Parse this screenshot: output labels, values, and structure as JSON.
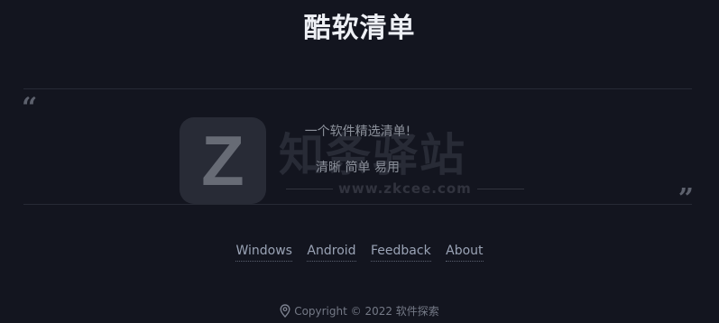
{
  "header": {
    "title": "酷软清单"
  },
  "quote": {
    "open_mark": "“",
    "close_mark": "”",
    "line1": "一个软件精选清单!",
    "line2": "清晰 简单 易用"
  },
  "watermark": {
    "logo_letter": "Z",
    "title": "知条驿站",
    "url": "www.zkcee.com"
  },
  "footer": {
    "links": [
      "Windows",
      "Android",
      "Feedback",
      "About"
    ],
    "copyright": "Copyright © 2022 软件探索",
    "icon": "location-pin-icon"
  },
  "colors": {
    "background": "#13151f",
    "title": "#eef0f5",
    "link": "#9aa3b5",
    "muted": "#8a8f99"
  }
}
